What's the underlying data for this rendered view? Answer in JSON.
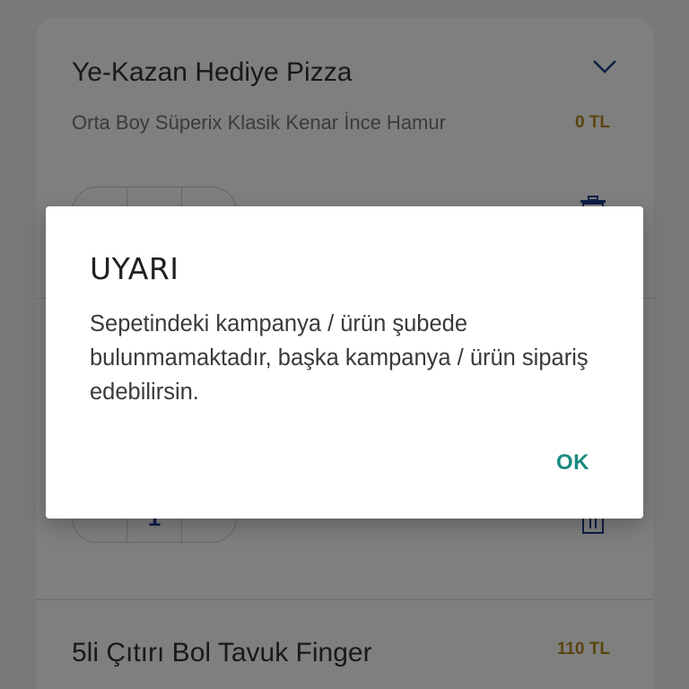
{
  "cart": {
    "items": [
      {
        "title": "Ye-Kazan Hediye Pizza",
        "description": "Orta Boy Süperix Klasik Kenar İnce Hamur",
        "price": "0 TL",
        "icon": "chevron-down-icon"
      },
      {
        "quantity": "1"
      },
      {
        "title": "5li Çıtırı Bol Tavuk Finger",
        "price": "110 TL"
      }
    ]
  },
  "dialog": {
    "title": "UYARI",
    "message": "Sepetindeki kampanya / ürün şubede bulunmamaktadır, başka kampanya / ürün sipariş edebilirsin.",
    "ok_label": "OK"
  },
  "colors": {
    "accent": "#1a8a80",
    "price": "#b48a1f",
    "brand": "#1e3c8c"
  }
}
